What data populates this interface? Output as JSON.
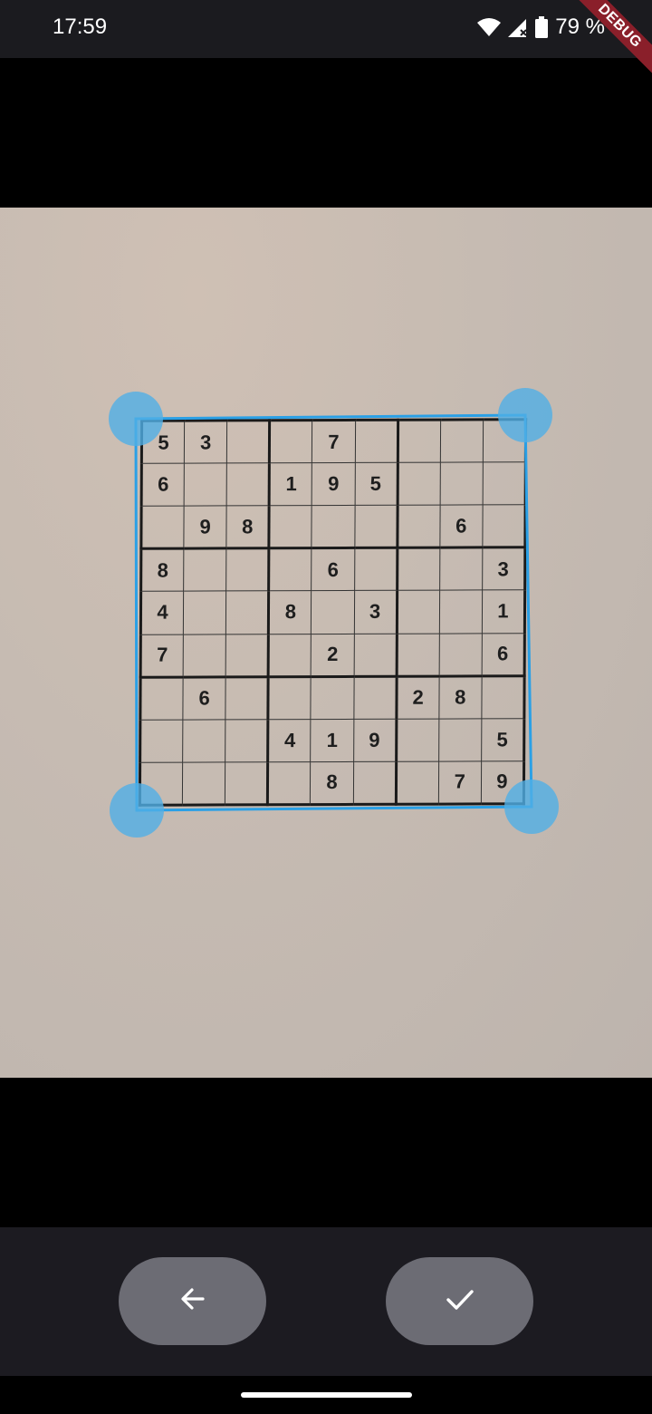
{
  "status_bar": {
    "time": "17:59",
    "battery_percent": "79 %",
    "icons": [
      "wifi-icon",
      "signal-icon",
      "battery-icon"
    ]
  },
  "debug_banner": "DEBUG",
  "sudoku": {
    "rows": [
      [
        "5",
        "3",
        "",
        "",
        "7",
        "",
        "",
        "",
        ""
      ],
      [
        "6",
        "",
        "",
        "1",
        "9",
        "5",
        "",
        "",
        ""
      ],
      [
        "",
        "9",
        "8",
        "",
        "",
        "",
        "",
        "6",
        ""
      ],
      [
        "8",
        "",
        "",
        "",
        "6",
        "",
        "",
        "",
        "3"
      ],
      [
        "4",
        "",
        "",
        "8",
        "",
        "3",
        "",
        "",
        "1"
      ],
      [
        "7",
        "",
        "",
        "",
        "2",
        "",
        "",
        "",
        "6"
      ],
      [
        "",
        "6",
        "",
        "",
        "",
        "",
        "2",
        "8",
        ""
      ],
      [
        "",
        "",
        "",
        "4",
        "1",
        "9",
        "",
        "",
        "5"
      ],
      [
        "",
        "",
        "",
        "",
        "8",
        "",
        "",
        "7",
        "9"
      ]
    ]
  },
  "crop": {
    "accent_color": "#2aa0e6",
    "handles": [
      "crop-handle-top-left",
      "crop-handle-top-right",
      "crop-handle-bottom-left",
      "crop-handle-bottom-right"
    ]
  },
  "bottom_bar": {
    "back_icon": "arrow-left-icon",
    "confirm_icon": "check-icon"
  }
}
